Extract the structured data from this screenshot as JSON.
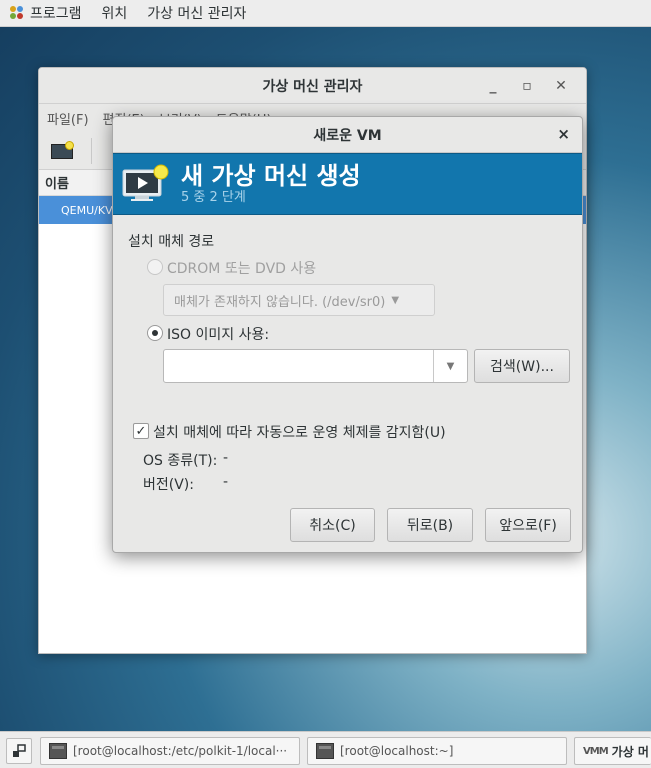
{
  "top_panel": {
    "applications": "프로그램",
    "places": "위치",
    "app_name": "가상 머신 관리자"
  },
  "main_window": {
    "title": "가상 머신 관리자",
    "menu": [
      "파일(F)",
      "편집(E)",
      "보기(V)",
      "도움말(H)"
    ],
    "column_header": "이름",
    "row_label": "QEMU/KVM"
  },
  "dialog": {
    "title": "새로운 VM",
    "close": "×",
    "banner_title": "새 가상 머신 생성",
    "banner_subtitle": "5 중 2 단계",
    "section_label": "설치 매체 경로",
    "cdrom_label": "CDROM 또는 DVD 사용",
    "cdrom_combo": "매체가 존재하지 않습니다. (/dev/sr0)",
    "iso_label": "ISO 이미지 사용:",
    "iso_value": "",
    "browse_button": "검색(W)...",
    "autodetect_label": "설치 매체에 따라 자동으로 운영 체제를 감지함(U)",
    "autodetect_checked": true,
    "os_type_label": "OS 종류(T):",
    "os_type_value": "-",
    "version_label": "버전(V):",
    "version_value": "-",
    "cancel_button": "취소(C)",
    "back_button": "뒤로(B)",
    "forward_button": "앞으로(F)"
  },
  "taskbar": {
    "task1": "[root@localhost:/etc/polkit-1/local···",
    "task2": "[root@localhost:~]",
    "task3": "가상 머"
  },
  "colors": {
    "banner": "#1276ad",
    "selection": "#4a90d9"
  }
}
